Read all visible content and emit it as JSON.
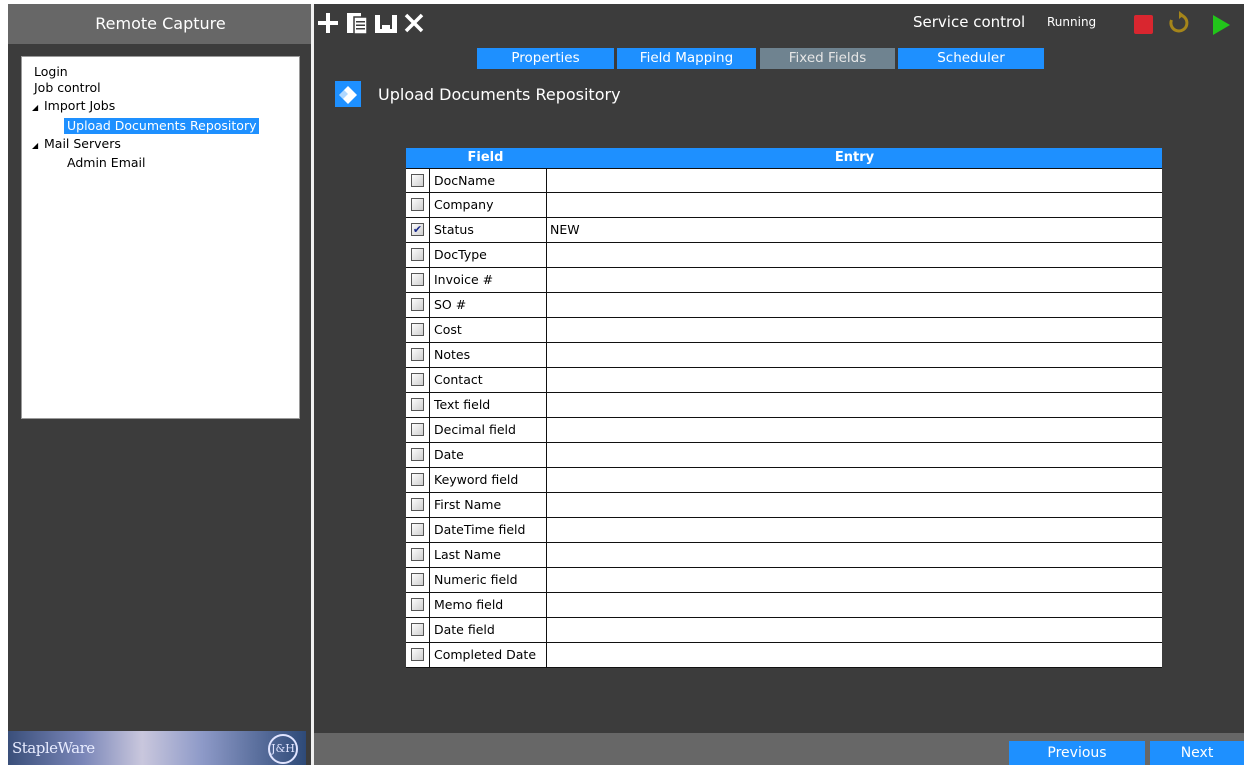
{
  "app": {
    "title": "Remote Capture"
  },
  "tree": {
    "items": [
      {
        "label": "Login",
        "level": 0,
        "expander": ""
      },
      {
        "label": "Job control",
        "level": 0,
        "expander": ""
      },
      {
        "label": "Import Jobs",
        "level": 0,
        "expander": "◢"
      },
      {
        "label": "Upload Documents Repository",
        "level": 1,
        "expander": "",
        "selected": true
      },
      {
        "label": "Mail Servers",
        "level": 0,
        "expander": "◢"
      },
      {
        "label": "Admin Email",
        "level": 1,
        "expander": ""
      }
    ]
  },
  "brand": {
    "name": "StapleWare",
    "seal": "J&H"
  },
  "toolbar": {
    "icons": [
      "plus-icon",
      "clipboard-icon",
      "save-icon",
      "close-icon"
    ],
    "service_label": "Service control",
    "service_status": "Running",
    "controls": [
      "stop-icon",
      "refresh-icon",
      "play-icon"
    ],
    "colors": {
      "stop": "#d9262f",
      "refresh": "#a5851a",
      "play": "#22c51a"
    }
  },
  "tabs": [
    {
      "label": "Properties",
      "active": true
    },
    {
      "label": "Field Mapping",
      "active": true
    },
    {
      "label": "Fixed Fields",
      "active": false
    },
    {
      "label": "Scheduler",
      "active": true
    }
  ],
  "section": {
    "title": "Upload Documents Repository",
    "icon": "eraser-icon"
  },
  "grid": {
    "headers": {
      "field": "Field",
      "entry": "Entry"
    },
    "rows": [
      {
        "checked": false,
        "field": "DocName",
        "entry": ""
      },
      {
        "checked": false,
        "field": "Company",
        "entry": ""
      },
      {
        "checked": true,
        "field": "Status",
        "entry": "NEW"
      },
      {
        "checked": false,
        "field": "DocType",
        "entry": ""
      },
      {
        "checked": false,
        "field": "Invoice #",
        "entry": ""
      },
      {
        "checked": false,
        "field": "SO #",
        "entry": ""
      },
      {
        "checked": false,
        "field": "Cost",
        "entry": ""
      },
      {
        "checked": false,
        "field": "Notes",
        "entry": ""
      },
      {
        "checked": false,
        "field": "Contact",
        "entry": ""
      },
      {
        "checked": false,
        "field": "Text field",
        "entry": ""
      },
      {
        "checked": false,
        "field": "Decimal field",
        "entry": ""
      },
      {
        "checked": false,
        "field": "Date",
        "entry": ""
      },
      {
        "checked": false,
        "field": "Keyword field",
        "entry": ""
      },
      {
        "checked": false,
        "field": "First Name",
        "entry": ""
      },
      {
        "checked": false,
        "field": "DateTime field",
        "entry": ""
      },
      {
        "checked": false,
        "field": "Last Name",
        "entry": ""
      },
      {
        "checked": false,
        "field": "Numeric field",
        "entry": ""
      },
      {
        "checked": false,
        "field": "Memo field",
        "entry": ""
      },
      {
        "checked": false,
        "field": "Date field",
        "entry": ""
      },
      {
        "checked": false,
        "field": "Completed Date",
        "entry": ""
      }
    ]
  },
  "footer": {
    "previous": "Previous",
    "next": "Next"
  },
  "colors": {
    "accent": "#1e90ff",
    "background": "#3c3c3c",
    "titlebar": "#676767",
    "inactive_tab": "#6f8390"
  }
}
